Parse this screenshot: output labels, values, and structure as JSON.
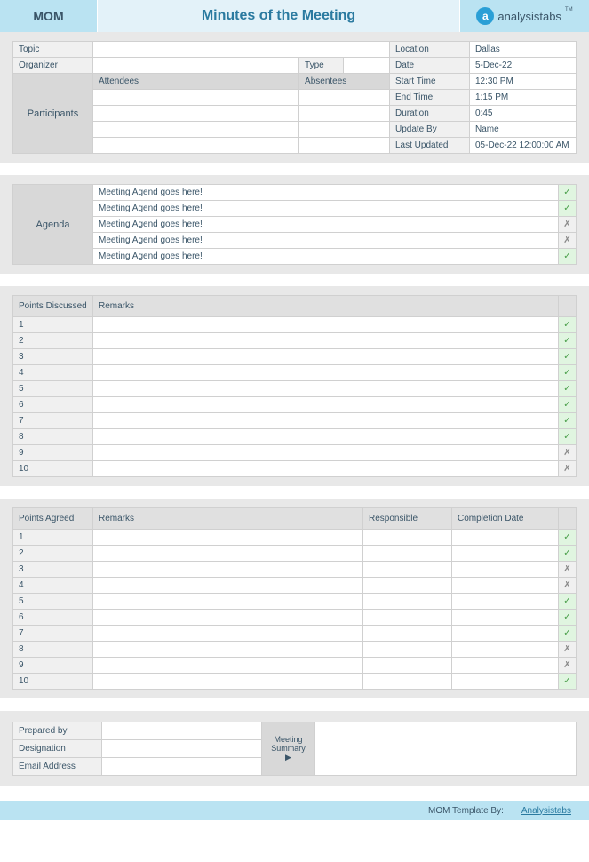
{
  "header": {
    "mom": "MOM",
    "title": "Minutes of the Meeting",
    "brand": "analysistabs"
  },
  "info": {
    "topic_label": "Topic",
    "topic": "",
    "organizer_label": "Organizer",
    "organizer": "",
    "type_label": "Type",
    "type": "",
    "participants_label": "Participants",
    "attendees_label": "Attendees",
    "absentees_label": "Absentees",
    "location_label": "Location",
    "location": "Dallas",
    "date_label": "Date",
    "date": "5-Dec-22",
    "start_label": "Start Time",
    "start": "12:30 PM",
    "end_label": "End Time",
    "end": "1:15 PM",
    "duration_label": "Duration",
    "duration": "0:45",
    "updateby_label": "Update By",
    "updateby": "Name",
    "lastupdated_label": "Last Updated",
    "lastupdated": "05-Dec-22 12:00:00 AM"
  },
  "agenda": {
    "label": "Agenda",
    "items": [
      {
        "text": "Meeting Agend goes here!",
        "status": "check"
      },
      {
        "text": "Meeting Agend goes here!",
        "status": "check"
      },
      {
        "text": "Meeting Agend goes here!",
        "status": "x"
      },
      {
        "text": "Meeting Agend goes here!",
        "status": "x"
      },
      {
        "text": "Meeting Agend goes here!",
        "status": "check"
      }
    ]
  },
  "discussed": {
    "col1": "Points Discussed",
    "col2": "Remarks",
    "rows": [
      {
        "n": "1",
        "r": "",
        "s": "check"
      },
      {
        "n": "2",
        "r": "",
        "s": "check"
      },
      {
        "n": "3",
        "r": "",
        "s": "check"
      },
      {
        "n": "4",
        "r": "",
        "s": "check"
      },
      {
        "n": "5",
        "r": "",
        "s": "check"
      },
      {
        "n": "6",
        "r": "",
        "s": "check"
      },
      {
        "n": "7",
        "r": "",
        "s": "check"
      },
      {
        "n": "8",
        "r": "",
        "s": "check"
      },
      {
        "n": "9",
        "r": "",
        "s": "x"
      },
      {
        "n": "10",
        "r": "",
        "s": "x"
      }
    ]
  },
  "agreed": {
    "col1": "Points Agreed",
    "col2": "Remarks",
    "col3": "Responsible",
    "col4": "Completion Date",
    "rows": [
      {
        "n": "1",
        "s": "check"
      },
      {
        "n": "2",
        "s": "check"
      },
      {
        "n": "3",
        "s": "x"
      },
      {
        "n": "4",
        "s": "x"
      },
      {
        "n": "5",
        "s": "check"
      },
      {
        "n": "6",
        "s": "check"
      },
      {
        "n": "7",
        "s": "check"
      },
      {
        "n": "8",
        "s": "x"
      },
      {
        "n": "9",
        "s": "x"
      },
      {
        "n": "10",
        "s": "check"
      }
    ]
  },
  "footer": {
    "prepared_label": "Prepared by",
    "designation_label": "Designation",
    "email_label": "Email Address",
    "summary_label1": "Meeting",
    "summary_label2": "Summary"
  },
  "credit": {
    "text": "MOM Template By:",
    "link": "Analysistabs"
  }
}
